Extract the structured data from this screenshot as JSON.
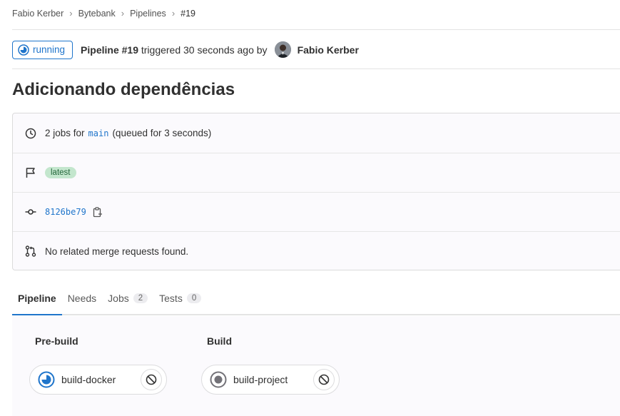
{
  "breadcrumb": [
    "Fabio Kerber",
    "Bytebank",
    "Pipelines",
    "#19"
  ],
  "header": {
    "status": "running",
    "pipeline_label": "Pipeline #19",
    "triggered_text": "triggered 30 seconds ago by",
    "author": "Fabio Kerber"
  },
  "title": "Adicionando dependências",
  "info": {
    "jobs_prefix": "2 jobs for",
    "branch": "main",
    "queued_text": "(queued for 3 seconds)",
    "tag": "latest",
    "commit_sha": "8126be79",
    "merge_requests": "No related merge requests found."
  },
  "tabs": [
    {
      "label": "Pipeline"
    },
    {
      "label": "Needs"
    },
    {
      "label": "Jobs",
      "count": "2"
    },
    {
      "label": "Tests",
      "count": "0"
    }
  ],
  "stages": [
    {
      "name": "Pre-build",
      "job": "build-docker",
      "status": "running"
    },
    {
      "name": "Build",
      "job": "build-project",
      "status": "created"
    }
  ],
  "colors": {
    "accent": "#1f75cb",
    "tag_bg": "#c3e6cd",
    "tag_text": "#24663b"
  }
}
